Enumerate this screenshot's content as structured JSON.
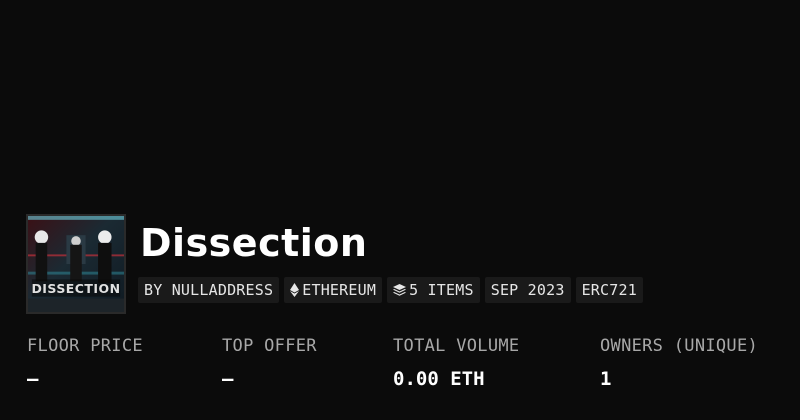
{
  "collection": {
    "title": "Dissection",
    "avatar_text": "DISSECTION",
    "creator_chip": "BY NULLADDRESS",
    "chain_chip": "ETHEREUM",
    "items_chip": "5 ITEMS",
    "date_chip": "SEP 2023",
    "standard_chip": "ERC721"
  },
  "stats": {
    "floor_label": "FLOOR PRICE",
    "floor_value": "—",
    "offer_label": "TOP OFFER",
    "offer_value": "—",
    "volume_label": "TOTAL VOLUME",
    "volume_value": "0.00 ETH",
    "owners_label": "OWNERS (UNIQUE)",
    "owners_value": "1"
  },
  "icons": {
    "chain": "ethereum-icon",
    "items": "layers-icon"
  },
  "colors": {
    "background": "#0b0b0b",
    "chip_bg": "#1a1a1a",
    "label": "#a8a8a8",
    "text": "#ffffff"
  }
}
